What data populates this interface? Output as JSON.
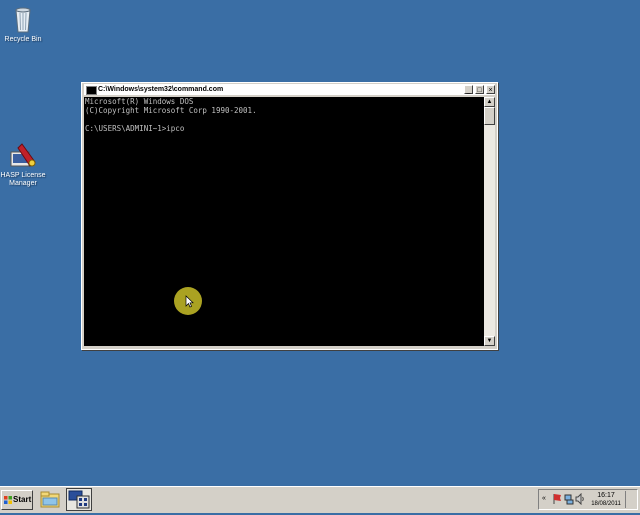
{
  "desktop": {
    "icons": [
      {
        "label": "Recycle Bin",
        "icon": "recycle-bin-icon"
      },
      {
        "label": "HASP License Manager",
        "icon": "hasp-license-manager-icon"
      }
    ]
  },
  "window": {
    "title": "C:\\Windows\\system32\\command.com",
    "console_lines": [
      "Microsoft(R) Windows DOS",
      "(C)Copyright Microsoft Corp 1990-2001.",
      "",
      "C:\\USERS\\ADMINI~1>ipco"
    ],
    "controls": {
      "minimize": "_",
      "maximize": "□",
      "close": "×"
    }
  },
  "taskbar": {
    "start_label": "Start",
    "quick_launch": [
      "explorer-icon",
      "server-manager-icon"
    ],
    "tray": {
      "time": "16:17",
      "date": "18/08/2011"
    }
  },
  "colors": {
    "desktop": "#3a6ea5",
    "console_bg": "#000000",
    "console_text": "#c0c0c0",
    "cursor_highlight": "#c8be28"
  }
}
